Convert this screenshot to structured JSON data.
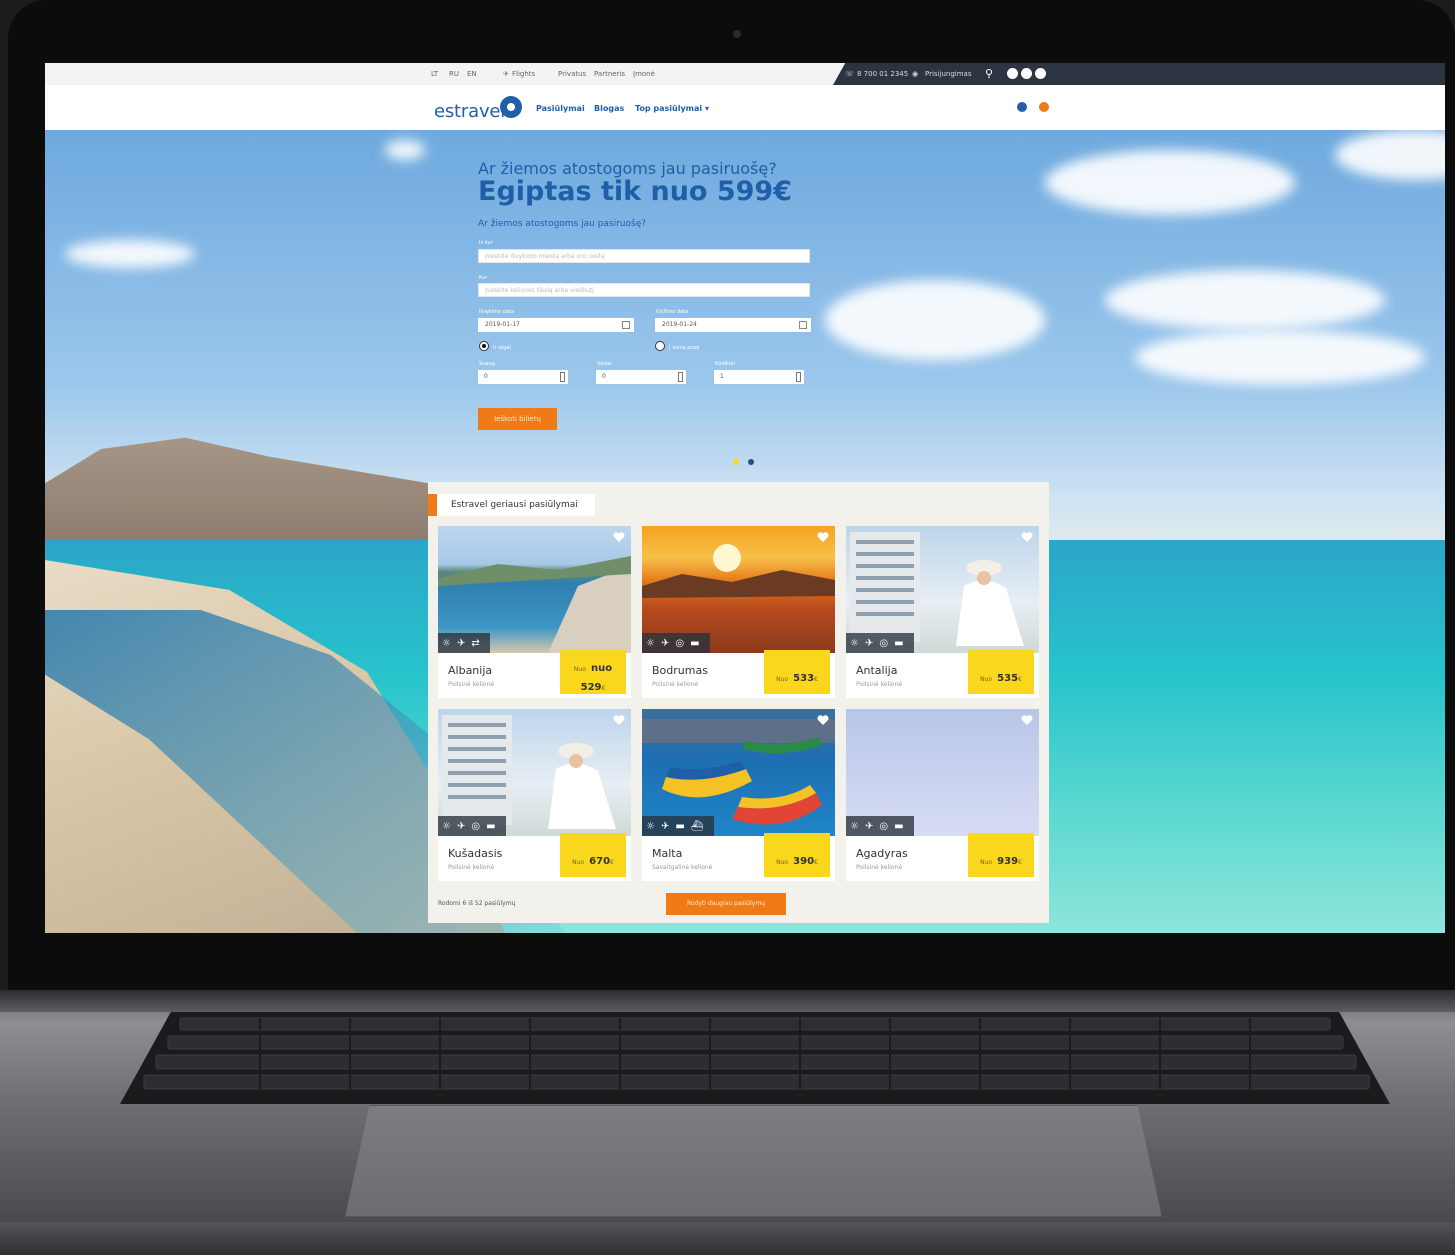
{
  "topbar": {
    "languages": [
      "LT",
      "RU",
      "EN"
    ],
    "links": [
      "Flights",
      "Privatus",
      "Partneris",
      "Įmonė"
    ],
    "phone": "8 700 01 2345",
    "login": "Prisijungimas"
  },
  "nav": {
    "logo_text": "estravel",
    "items": [
      "Pasiūlymai",
      "Blogas",
      "Top pasiūlymai ▾"
    ]
  },
  "hero": {
    "subtitle": "Ar žiemos atostogoms jau pasiruošę?",
    "title": "Egiptas tik nuo 599€",
    "question": "Ar žiemos atostogoms jau pasiruošę?",
    "form": {
      "from_label": "Iš kur",
      "from_placeholder": "Įveskite išvykimo miestą arba oro uostą",
      "to_label": "Kur",
      "to_placeholder": "Įveskite kelionės tikslą arba viešbutį",
      "date_from_label": "Išvykimo data",
      "date_from": "2019-01-17",
      "date_to_label": "Grįžimo data",
      "date_to": "2019-01-24",
      "radio1": "Ir atgal",
      "radio2": "Į vieną pusę",
      "adults_label": "Suaug.",
      "adults": "0",
      "children_label": "Vaikai",
      "children": "0",
      "infants_label": "Kūdikiai",
      "infants": "1",
      "search_button": "Ieškoti bilietų"
    }
  },
  "offers": {
    "tab_label": "Estravel geriausi pasiūlymai",
    "price_prefix": "Nuo",
    "cards": [
      {
        "name": "Albanija",
        "type": "Poilsinė kelionė",
        "price_word": "nuo",
        "price": "529",
        "currency": "€"
      },
      {
        "name": "Bodrumas",
        "type": "Poilsinė kelionė",
        "price": "533",
        "currency": "€"
      },
      {
        "name": "Antalija",
        "type": "Poilsinė kelionė",
        "price": "535",
        "currency": "€"
      },
      {
        "name": "Kušadasis",
        "type": "Poilsinė kelionė",
        "price": "670",
        "currency": "€"
      },
      {
        "name": "Malta",
        "type": "Savaitgalinė kelionė",
        "price": "390",
        "currency": "€"
      },
      {
        "name": "Agadyras",
        "type": "Poilsinė kelionė",
        "price": "939",
        "currency": "€"
      }
    ],
    "shown_text": "Rodomi 6 iš 52 pasiūlymų",
    "more_button": "Rodyti daugiau pasiūlymų"
  },
  "colors": {
    "brand_blue": "#1f5fa8",
    "accent_orange": "#f07b16",
    "price_yellow": "#f8d71c"
  }
}
